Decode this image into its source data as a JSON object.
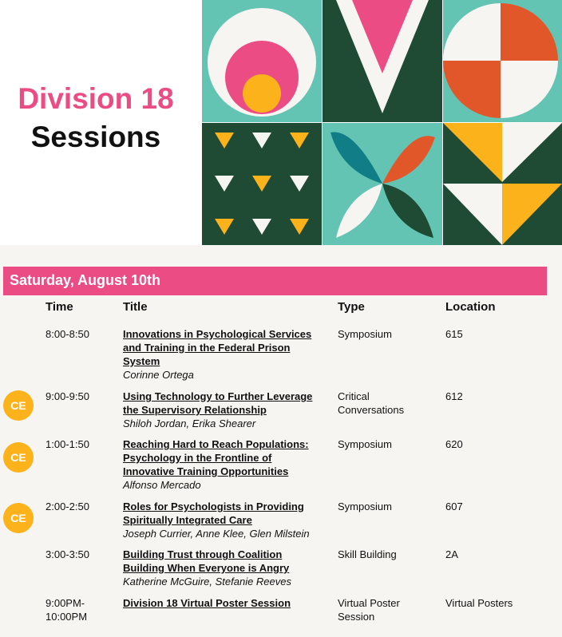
{
  "header": {
    "title_line1": "Division 18",
    "title_line2": "Sessions"
  },
  "colors": {
    "pink": "#ec4c84",
    "dark_green": "#1f4a33",
    "teal": "#63c4b4",
    "orange": "#e2572a",
    "yellow": "#fbb21b"
  },
  "schedule": {
    "day": "Saturday, August 10th",
    "columns": {
      "time": "Time",
      "title": "Title",
      "type": "Type",
      "location": "Location"
    },
    "ce_badge": "CE",
    "rows": [
      {
        "time": "8:00-8:50",
        "title_l1": "Innovations in Psychological Services",
        "title_l2": "and Training in the Federal Prison",
        "title_l3": "System",
        "presenters": "Corinne Ortega",
        "type_l1": "Symposium",
        "type_l2": "",
        "location": "615",
        "ce": false
      },
      {
        "time": "9:00-9:50",
        "title_l1": "Using Technology to Further Leverage",
        "title_l2": "the Supervisory Relationship",
        "title_l3": "",
        "presenters": "Shiloh Jordan, Erika Shearer",
        "type_l1": "Critical",
        "type_l2": "Conversations",
        "location": "612",
        "ce": true
      },
      {
        "time": "1:00-1:50",
        "title_l1": "Reaching Hard to Reach Populations:",
        "title_l2": "Psychology in the Frontline of",
        "title_l3": "Innovative Training Opportunities",
        "presenters": "Alfonso Mercado",
        "type_l1": "Symposium",
        "type_l2": "",
        "location": "620",
        "ce": true
      },
      {
        "time": "2:00-2:50",
        "title_l1": "Roles for Psychologists in Providing",
        "title_l2": "Spiritually Integrated Care",
        "title_l3": "",
        "presenters": "Joseph Currier, Anne Klee, Glen Milstein",
        "type_l1": "Symposium",
        "type_l2": "",
        "location": "607",
        "ce": true
      },
      {
        "time": "3:00-3:50",
        "title_l1": "Building Trust through Coalition",
        "title_l2": "Building When Everyone is Angry",
        "title_l3": "",
        "presenters": "Katherine McGuire, Stefanie Reeves",
        "type_l1": "Skill Building",
        "type_l2": "",
        "location": "2A",
        "ce": false
      },
      {
        "time_l1": "9:00PM-",
        "time_l2": "10:00PM",
        "title_l1": "Division 18 Virtual Poster Session",
        "title_l2": "",
        "title_l3": "",
        "presenters": "",
        "type_l1": "Virtual Poster",
        "type_l2": "Session",
        "location": "Virtual Posters",
        "ce": false
      }
    ]
  }
}
